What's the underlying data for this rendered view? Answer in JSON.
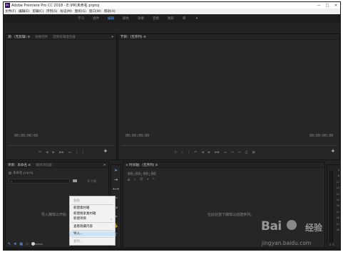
{
  "window": {
    "logo_text": "Pr",
    "title": "Adobe Premiere Pro CC 2018 - E:\\PR\\未命名.prproj",
    "minimize": "—",
    "maximize": "□",
    "close": "✕"
  },
  "menubar": {
    "items": [
      "文件(F)",
      "编辑(E)",
      "剪辑(C)",
      "序列(S)",
      "标记(M)",
      "图形(G)",
      "窗口(W)",
      "帮助(H)"
    ]
  },
  "workspaces": {
    "tabs": [
      "学习",
      "组件",
      "编辑",
      "颜色",
      "效果",
      "音频",
      "图形",
      "库"
    ],
    "active": "编辑",
    "more": "»"
  },
  "source_panel": {
    "tabs": [
      "源：(无剪辑) ≡",
      "效果控件",
      "音频剪辑混合器"
    ],
    "more": "»",
    "timecode": "00;00;00;00",
    "transport": [
      "⏮",
      "◀",
      "▶",
      "▶▶",
      "⏭",
      "{",
      "}"
    ],
    "add": "+"
  },
  "program_panel": {
    "tabs": [
      "节目：(无序列) ≡"
    ],
    "timecode_left": "00;00;00;00",
    "timecode_right": "00;00;00;00",
    "transport": [
      "⦿",
      "{",
      "}",
      "⏮",
      "◀",
      "▶",
      "▶▶",
      "⏭",
      "⇔",
      "⇔",
      "⎙",
      "▣"
    ],
    "add": "+"
  },
  "project_panel": {
    "tabs": [
      "项目：未命名 ≡",
      "媒体浏览器"
    ],
    "more": "»",
    "file_name": "未命名.prproj",
    "search_placeholder": "",
    "items_count": "0 个项",
    "drop_hint": "导入媒体以开始"
  },
  "timeline_panel": {
    "tab": "× 时间轴：(无序列) ≡",
    "timecode": "00;00;00;00",
    "empty_hint": "在此处放下媒体以创建序列。"
  },
  "meters": {
    "scale": [
      "0",
      "-6",
      "-12",
      "-18",
      "-24",
      "-30",
      "-36",
      "-42",
      "-48",
      "-54",
      "dB"
    ],
    "foot": "S S"
  },
  "context_menu": {
    "items": [
      {
        "label": "粘贴",
        "disabled": true,
        "arrow": ""
      },
      {
        "label": "新建素材箱",
        "disabled": false,
        "arrow": ""
      },
      {
        "label": "新建搜索素材箱",
        "disabled": false,
        "arrow": ""
      },
      {
        "label": "新建项目",
        "disabled": false,
        "arrow": "›"
      },
      {
        "label": "查看隐藏内容",
        "disabled": false,
        "arrow": ""
      },
      {
        "label": "导入...",
        "disabled": false,
        "arrow": "",
        "highlighted": true
      },
      {
        "label": "查找...",
        "disabled": true,
        "arrow": ""
      }
    ]
  },
  "watermark": {
    "logo": "Bai",
    "logo_suffix": "经验",
    "url": "jingyan.baidu.com"
  }
}
